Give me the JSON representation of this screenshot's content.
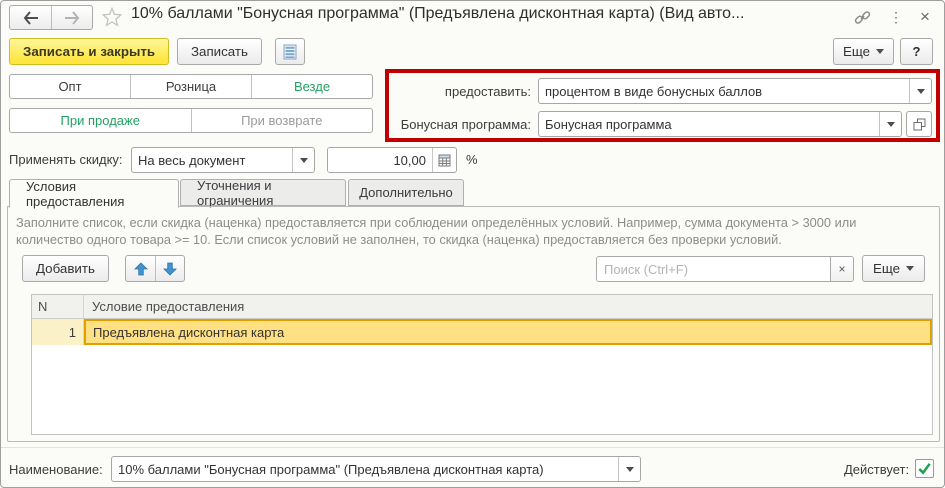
{
  "colors": {
    "highlight_frame": "#c00000",
    "accent_green": "#23a164",
    "selection_yellow": "#ffe184",
    "primary_button_yellow": "#ffe53e",
    "arrow_blue": "#3f93d0"
  },
  "titlebar": {
    "title": "10% баллами \"Бонусная программа\" (Предъявлена дисконтная карта) (Вид авто...",
    "kebab": "⋮",
    "close": "×"
  },
  "commandbar": {
    "save_and_close": "Записать и закрыть",
    "save": "Записать",
    "more": "Еще",
    "help": "?"
  },
  "filters": {
    "scope": {
      "options": [
        "Опт",
        "Розница",
        "Везде"
      ],
      "selected": "Везде"
    },
    "moment": {
      "options": [
        "При продаже",
        "При возврате"
      ],
      "selected": "При продаже"
    }
  },
  "provide_field": {
    "label": "предоставить:",
    "value": "процентом в виде бонусных баллов"
  },
  "program_field": {
    "label": "Бонусная программа:",
    "value": "Бонусная программа"
  },
  "apply_field": {
    "label": "Применять скидку:",
    "value": "На весь документ",
    "percent": "10,00",
    "unit": "%"
  },
  "tabs": [
    {
      "label": "Условия предоставления"
    },
    {
      "label": "Уточнения и ограничения"
    },
    {
      "label": "Дополнительно"
    }
  ],
  "conditions": {
    "hint": "Заполните список, если скидка (наценка) предоставляется при соблюдении определённых условий. Например, сумма документа > 3000 или количество одного товара >= 10. Если список условий не заполнен, то скидка (наценка) предоставляется без проверки условий.",
    "add_button": "Добавить",
    "search_placeholder": "Поиск (Ctrl+F)",
    "clear_button": "×",
    "more_button": "Еще",
    "table": {
      "columns": [
        "N",
        "Условие предоставления"
      ],
      "rows": [
        {
          "n": "1",
          "condition": "Предъявлена дисконтная карта"
        }
      ]
    }
  },
  "footer": {
    "name_label": "Наименование:",
    "name_value": "10% баллами \"Бонусная программа\" (Предъявлена дисконтная карта)",
    "active_label": "Действует:"
  }
}
